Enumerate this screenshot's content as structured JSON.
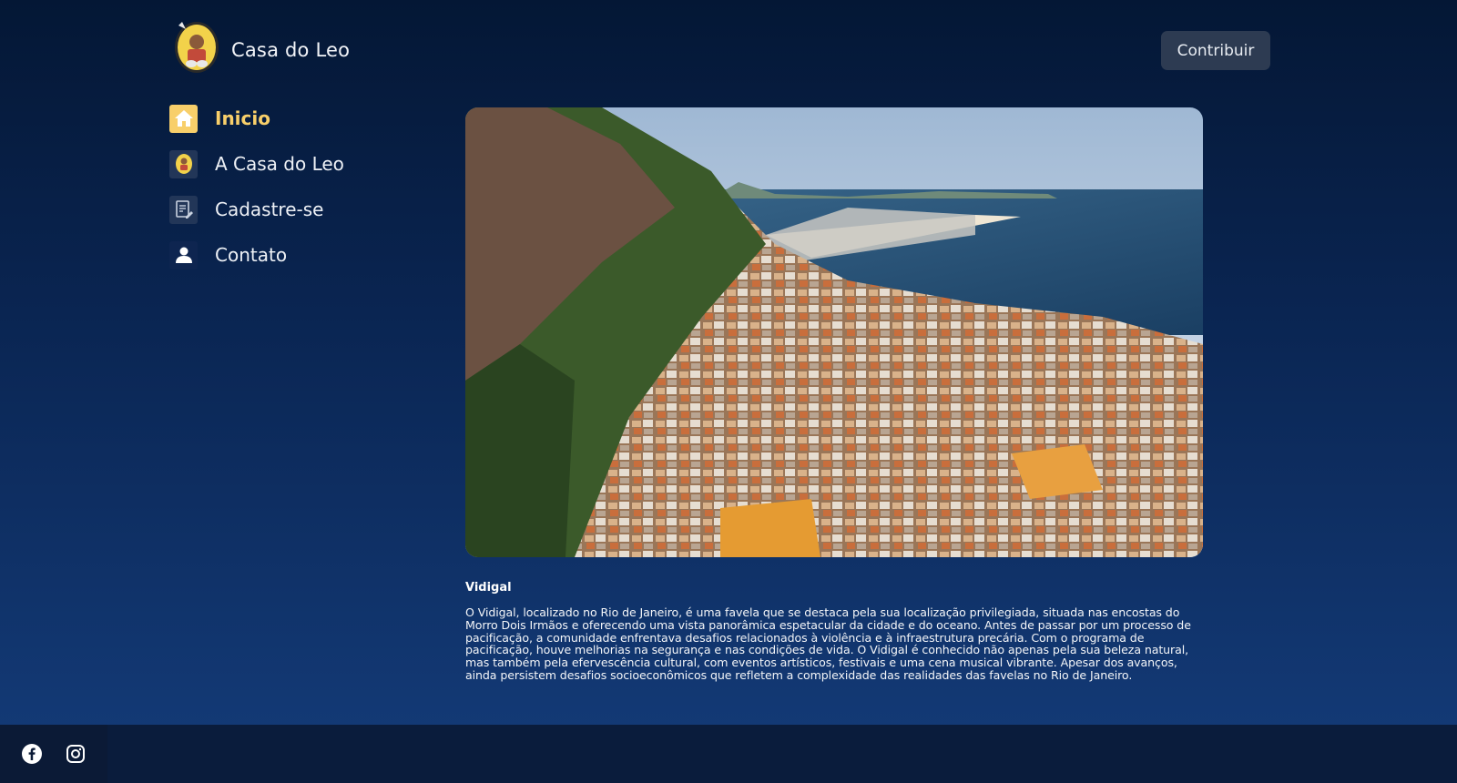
{
  "brand": {
    "name": "Casa do Leo",
    "logo_icon": "casa-do-leo-logo"
  },
  "header": {
    "contribute_label": "Contribuir"
  },
  "nav": {
    "items": [
      {
        "label": "Inicio",
        "icon": "home-icon",
        "active": true
      },
      {
        "label": "A Casa do Leo",
        "icon": "casa-do-leo-mini-logo",
        "active": false
      },
      {
        "label": "Cadastre-se",
        "icon": "register-form-icon",
        "active": false
      },
      {
        "label": "Contato",
        "icon": "person-icon",
        "active": false
      }
    ]
  },
  "article": {
    "image_alt": "Vidigal",
    "title": "Vidigal",
    "body": "O Vidigal, localizado no Rio de Janeiro, é uma favela que se destaca pela sua localização privilegiada, situada nas encostas do Morro Dois Irmãos e oferecendo uma vista panorâmica espetacular da cidade e do oceano. Antes de passar por um processo de pacificação, a comunidade enfrentava desafios relacionados à violência e à infraestrutura precária. Com o programa de pacificação, houve melhorias na segurança e nas condições de vida. O Vidigal é conhecido não apenas pela sua beleza natural, mas também pela efervescência cultural, com eventos artísticos, festivais e uma cena musical vibrante. Apesar dos avanços, ainda persistem desafios socioeconômicos que refletem a complexidade das realidades das favelas no Rio de Janeiro."
  },
  "footer": {
    "social": [
      {
        "name": "facebook-icon"
      },
      {
        "name": "instagram-icon"
      }
    ]
  },
  "colors": {
    "accent": "#f8cf6a",
    "button_bg": "#2d3b52",
    "footer_bg": "#0a1c3c"
  }
}
